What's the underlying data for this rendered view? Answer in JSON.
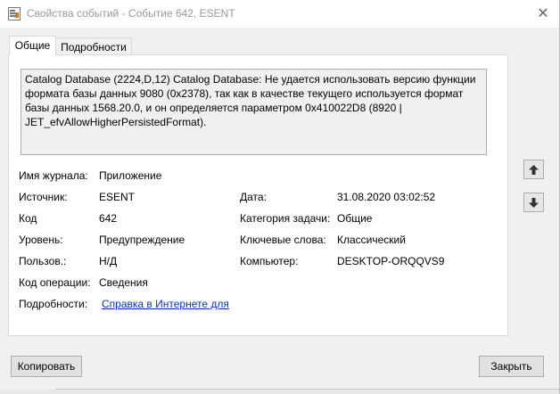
{
  "window": {
    "title": "Свойства событий - Событие 642, ESENT"
  },
  "tabs": [
    {
      "label": "Общие",
      "selected": true
    },
    {
      "label": "Подробности",
      "selected": false
    }
  ],
  "description": "Catalog Database (2224,D,12) Catalog Database: Не удается использовать версию функции формата базы данных 9080 (0x2378), так как в качестве текущего используется формат базы данных 1568.20.0, и он определяется параметром 0x410022D8 (8920 | JET_efvAllowHigherPersistedFormat).",
  "fields": {
    "log_name": {
      "label": "Имя журнала:",
      "value": "Приложение"
    },
    "source": {
      "label": "Источник:",
      "value": "ESENT"
    },
    "date": {
      "label": "Дата:",
      "value": "31.08.2020 03:02:52"
    },
    "event_id": {
      "label": "Код",
      "value": "642"
    },
    "task_category": {
      "label": "Категория задачи:",
      "value": "Общие"
    },
    "level": {
      "label": "Уровень:",
      "value": "Предупреждение"
    },
    "keywords": {
      "label": "Ключевые слова:",
      "value": "Классический"
    },
    "user": {
      "label": "Пользов.:",
      "value": "Н/Д"
    },
    "computer": {
      "label": "Компьютер:",
      "value": "DESKTOP-ORQQVS9"
    },
    "opcode": {
      "label": "Код операции:",
      "value": "Сведения"
    },
    "more_info": {
      "label": "Подробности:",
      "value": "Справка в Интернете для "
    }
  },
  "buttons": {
    "copy": "Копировать",
    "close": "Закрыть"
  },
  "icons": {
    "app": "event-viewer-icon",
    "close": "close-icon",
    "up": "arrow-up-icon",
    "down": "arrow-down-icon"
  }
}
